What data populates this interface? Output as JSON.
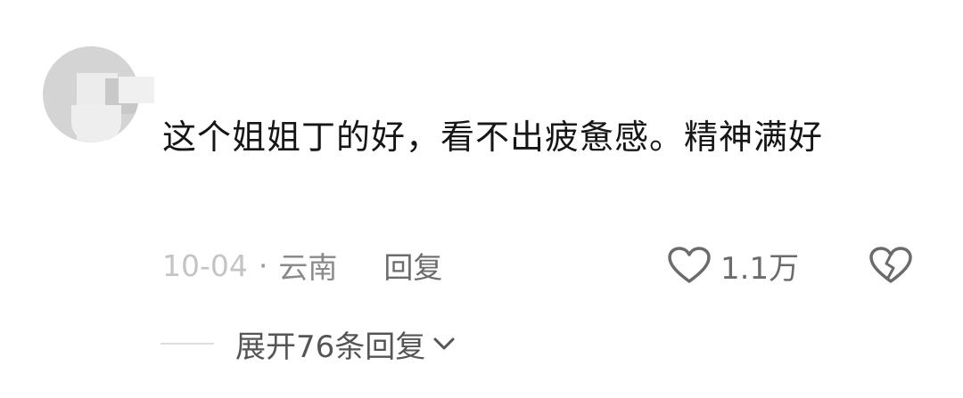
{
  "comment": {
    "text": "这个姐姐丁的好，看不出疲惫感。精神满好",
    "date": "10-04",
    "separator": "·",
    "location": "云南",
    "reply_label": "回复",
    "likes": "1.1万",
    "expand_label": "展开76条回复"
  },
  "icons": {
    "like": "heart-outline-icon",
    "dislike": "broken-heart-icon",
    "expand": "chevron-down-icon"
  },
  "colors": {
    "text": "#161616",
    "meta": "#8a8a8a",
    "icon": "#6b6b6b"
  }
}
